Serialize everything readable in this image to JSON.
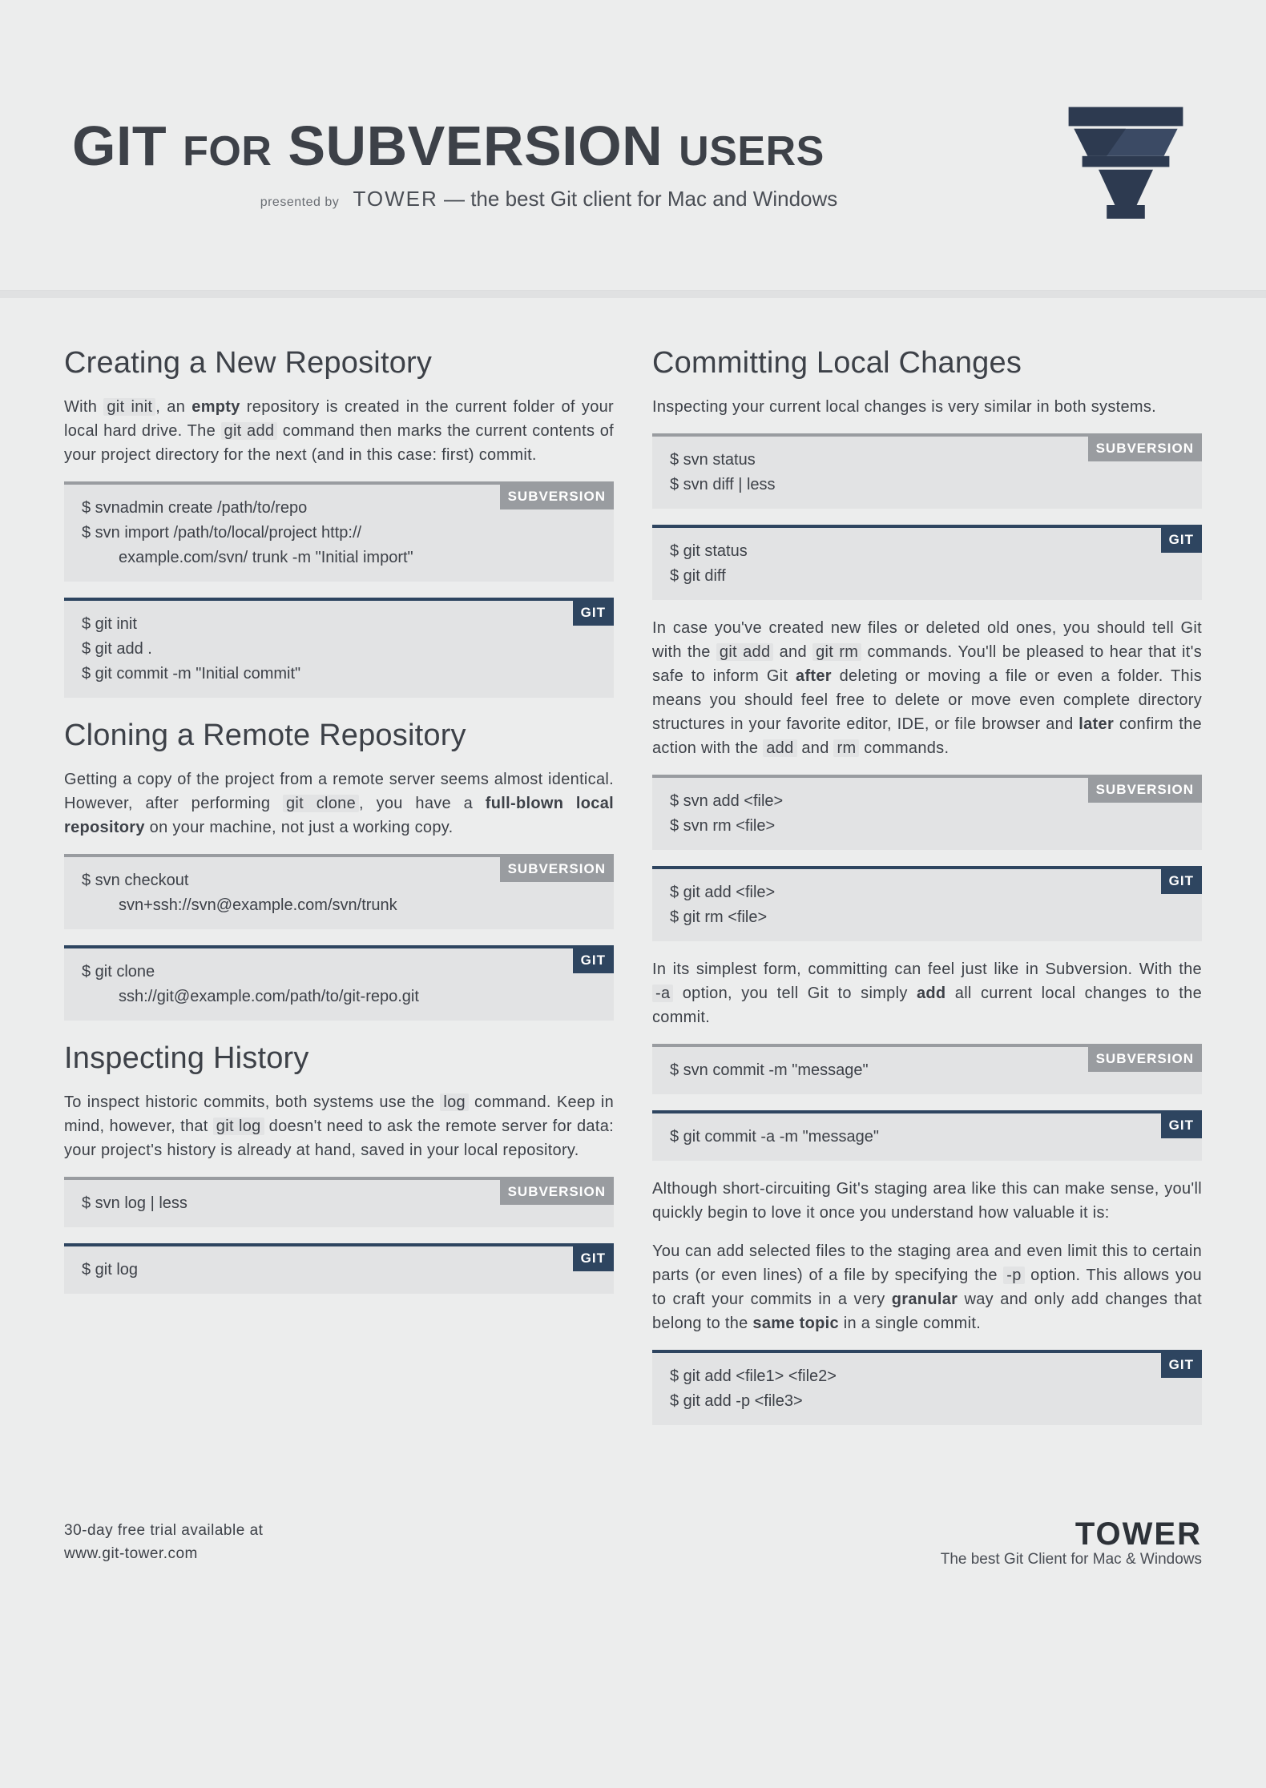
{
  "hero": {
    "title_1": "GIT",
    "title_for": "FOR",
    "title_2": "SUBVERSION",
    "title_users": "USERS",
    "presented": "presented by",
    "tower": "TOWER",
    "tagline": " — the best Git client for Mac and Windows"
  },
  "badge_svn": "SUBVERSION",
  "badge_git": "GIT",
  "left": {
    "s1_title": "Creating a New Repository",
    "s1_p_a": "With ",
    "s1_p_hl1": "git init",
    "s1_p_b": ", an ",
    "s1_p_bold1": "empty",
    "s1_p_c": " repository is created in the current folder of your local hard drive. The ",
    "s1_p_hl2": "git add",
    "s1_p_d": " command then marks the current contents of your project directory for the next (and in this case: first) commit.",
    "s1_svn_l1": "$ svnadmin create /path/to/repo",
    "s1_svn_l2": "$ svn import /path/to/local/project http://",
    "s1_svn_l2b": "example.com/svn/ trunk -m \"Initial import\"",
    "s1_git_l1": "$ git init",
    "s1_git_l2": "$ git add .",
    "s1_git_l3": "$ git commit -m \"Initial commit\"",
    "s2_title": "Cloning a Remote Repository",
    "s2_p_a": "Getting a copy of the project from a remote server seems almost identical. However, after performing ",
    "s2_p_hl1": "git clone",
    "s2_p_b": ", you have a ",
    "s2_p_bold1": "full-blown local repository",
    "s2_p_c": " on your machine, not just a working copy.",
    "s2_svn_l1": "$ svn checkout",
    "s2_svn_l2": "svn+ssh://svn@example.com/svn/trunk",
    "s2_git_l1": "$ git clone",
    "s2_git_l2": "ssh://git@example.com/path/to/git-repo.git",
    "s3_title": "Inspecting History",
    "s3_p_a": "To inspect historic commits, both systems use the ",
    "s3_p_hl1": "log",
    "s3_p_b": " command. Keep in mind, however, that ",
    "s3_p_hl2": "git log",
    "s3_p_c": " doesn't need to ask the remote server for data: your project's history is already at hand, saved in your local repository.",
    "s3_svn_l1": "$ svn log | less",
    "s3_git_l1": "$ git log"
  },
  "right": {
    "s1_title": "Committing Local Changes",
    "s1_p1": "Inspecting your current local changes is very similar in both systems.",
    "s1_svn_l1": "$ svn status",
    "s1_svn_l2": "$ svn diff | less",
    "s1_git_l1": "$ git status",
    "s1_git_l2": "$ git diff",
    "s1_p2_a": "In case you've created new files or deleted old ones, you should tell Git with the ",
    "s1_p2_hl1": "git add",
    "s1_p2_b": " and ",
    "s1_p2_hl2": "git rm",
    "s1_p2_c": " commands. You'll be pleased to hear that it's safe to inform Git ",
    "s1_p2_bold1": "after",
    "s1_p2_d": " deleting or moving a file or even a folder. This means you should feel free to delete or move even complete directory structures in your favorite editor, IDE, or file browser and ",
    "s1_p2_bold2": "later",
    "s1_p2_e": " confirm the action with the ",
    "s1_p2_hl3": "add",
    "s1_p2_f": " and ",
    "s1_p2_hl4": "rm",
    "s1_p2_g": " commands.",
    "s1b_svn_l1": "$ svn add <file>",
    "s1b_svn_l2": "$ svn rm <file>",
    "s1b_git_l1": "$ git add <file>",
    "s1b_git_l2": "$ git rm <file>",
    "s1_p3_a": "In its simplest form, committing can feel just like in Subversion. With the ",
    "s1_p3_hl1": "-a",
    "s1_p3_b": " option, you tell Git to simply ",
    "s1_p3_bold1": "add",
    "s1_p3_c": " all current local changes to the commit.",
    "s1c_svn_l1": "$ svn commit -m \"message\"",
    "s1c_git_l1": "$ git commit -a -m \"message\"",
    "s1_p4": "Although short-circuiting Git's staging area like this can make sense, you'll quickly begin to love it once you understand how valuable it is:",
    "s1_p5_a": "You can add selected files to the staging area and even limit this to certain parts (or even lines) of a file by specifying the ",
    "s1_p5_hl1": "-p",
    "s1_p5_b": " option. This allows you to craft your commits in a very ",
    "s1_p5_bold1": "granular",
    "s1_p5_c": " way and only add changes that belong to the ",
    "s1_p5_bold2": "same topic",
    "s1_p5_d": " in a single commit.",
    "s1d_git_l1": "$ git add <file1> <file2>",
    "s1d_git_l2": "$ git add -p <file3>"
  },
  "footer": {
    "trial_l1": "30-day free trial available at",
    "trial_l2": "www.git-tower.com",
    "tower_name": "TOWER",
    "tower_tag": "The best Git Client for Mac & Windows"
  }
}
